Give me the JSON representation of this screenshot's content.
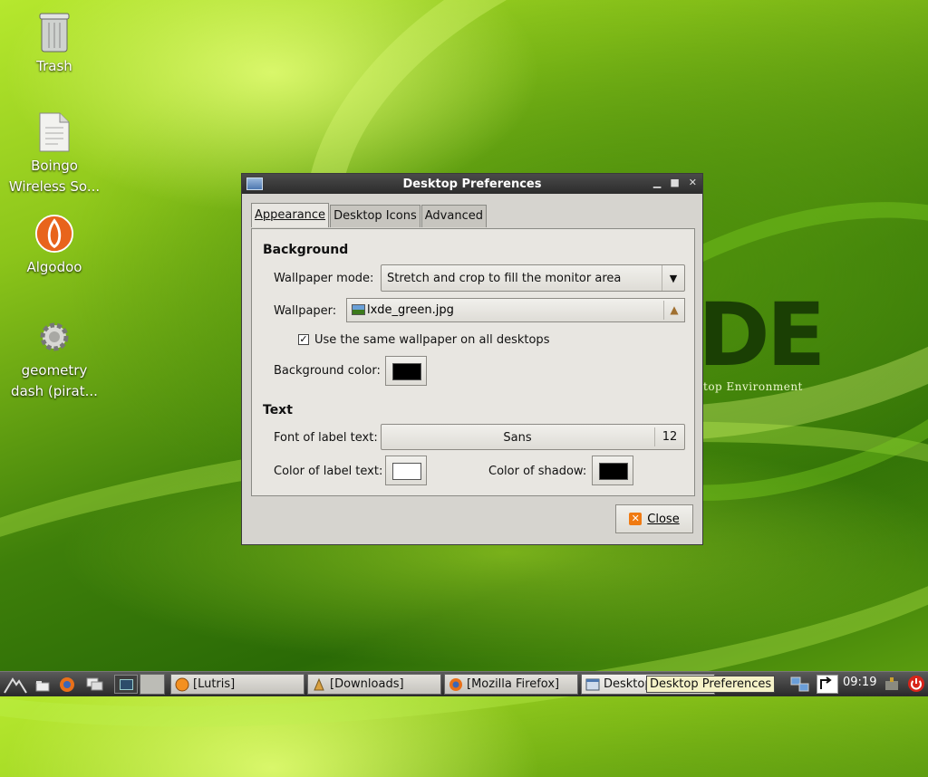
{
  "desktop": {
    "icons": [
      {
        "label": "Trash",
        "icon": "trash-icon"
      },
      {
        "label": "Boingo\nWireless So...",
        "icon": "document-icon"
      },
      {
        "label": "Algodoo",
        "icon": "algodoo-icon"
      },
      {
        "label": "geometry\ndash (pirat...",
        "icon": "gear-icon"
      }
    ],
    "wallpaper_logo": "DE",
    "wallpaper_subtitle": "top Environment"
  },
  "dialog": {
    "title": "Desktop Preferences",
    "tabs": [
      "Appearance",
      "Desktop Icons",
      "Advanced"
    ],
    "active_tab": "Appearance",
    "background_section": "Background",
    "wallpaper_mode_label": "Wallpaper mode:",
    "wallpaper_mode_value": "Stretch and crop to fill the monitor area",
    "wallpaper_label": "Wallpaper:",
    "wallpaper_file": "lxde_green.jpg",
    "same_wallpaper_label": "Use the same wallpaper on all desktops",
    "same_wallpaper_checked": true,
    "background_color_label": "Background color:",
    "background_color": "#000000",
    "text_section": "Text",
    "font_label": "Font of label text:",
    "font_name": "Sans",
    "font_size": "12",
    "label_color_label": "Color of label text:",
    "label_color": "#ffffff",
    "shadow_color_label": "Color of shadow:",
    "shadow_color": "#000000",
    "close_label": "Close"
  },
  "taskbar": {
    "tasks": [
      {
        "label": "[Lutris]",
        "icon": "lutris-icon"
      },
      {
        "label": "[Downloads]",
        "icon": "folder-icon"
      },
      {
        "label": "[Mozilla Firefox]",
        "icon": "firefox-icon"
      },
      {
        "label": "Desktop",
        "icon": "window-icon"
      }
    ],
    "tooltip": "Desktop Preferences",
    "clock": "09:19"
  }
}
